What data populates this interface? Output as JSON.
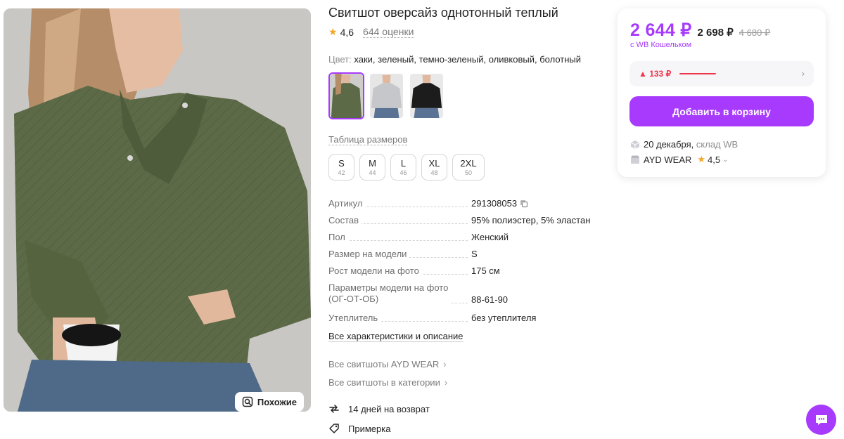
{
  "product": {
    "title": "Свитшот оверсайз однотонный теплый",
    "rating": "4,6",
    "reviews": "644 оценки",
    "color_label": "Цвет:",
    "color_value": "хаки, зеленый, темно-зеленый, оливковый, болотный",
    "similar_label": "Похожие",
    "swatch_colors": [
      "#5d6a48",
      "#c9c9cc",
      "#1c1c1c"
    ],
    "size_table_label": "Таблица размеров",
    "sizes": [
      {
        "label": "S",
        "num": "42"
      },
      {
        "label": "M",
        "num": "44"
      },
      {
        "label": "L",
        "num": "46"
      },
      {
        "label": "XL",
        "num": "48"
      },
      {
        "label": "2XL",
        "num": "50"
      }
    ]
  },
  "specs": [
    {
      "key": "Артикул",
      "value": "291308053"
    },
    {
      "key": "Состав",
      "value": "95% полиэстер, 5% эластан"
    },
    {
      "key": "Пол",
      "value": "Женский"
    },
    {
      "key": "Размер на модели",
      "value": "S"
    },
    {
      "key": "Рост модели на фото",
      "value": "175 см"
    },
    {
      "key": "Параметры модели на фото",
      "key2": "(ОГ-ОТ-ОБ)",
      "value": "88-61-90"
    },
    {
      "key": "Утеплитель",
      "value": "без утеплителя"
    }
  ],
  "links": {
    "all_specs": "Все характеристики и описание",
    "brand_category": "Все свитшоты AYD WEAR",
    "category": "Все свитшоты в категории"
  },
  "perks": {
    "returns": "14 дней на возврат",
    "fitting": "Примерка"
  },
  "price": {
    "wallet_price": "2 644 ₽",
    "regular_price": "2 698 ₽",
    "old_price": "4 680 ₽",
    "wallet_note": "с WB Кошельком",
    "trend_delta": "▲ 133 ₽",
    "add_to_cart": "Добавить в корзину",
    "delivery_date": "20 декабря,",
    "delivery_warehouse": "склад WB",
    "seller_name": "AYD WEAR",
    "seller_rating": "4,5"
  },
  "colors": {
    "accent": "#a73afd",
    "price_up": "#f0364a",
    "star": "#f5a623"
  }
}
